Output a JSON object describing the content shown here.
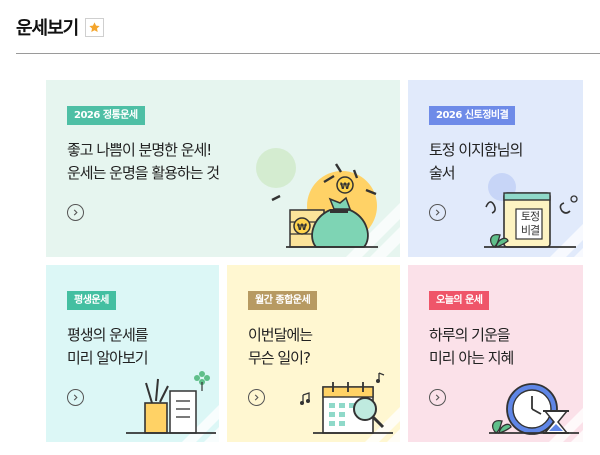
{
  "header": {
    "title": "운세보기",
    "favorite_icon": "star-icon"
  },
  "colors": {
    "badge_teal": "#4ebfa5",
    "badge_blue": "#6e8be8",
    "badge_green": "#44bfa1",
    "badge_brown": "#b79a62",
    "badge_red": "#ef5569"
  },
  "cards": [
    {
      "badge": "2026 정통운세",
      "title_lines": [
        "좋고 나쁨이 분명한 운세!",
        "운세는 운명을 활용하는 것"
      ],
      "icon": "money-bag-icon"
    },
    {
      "badge": "2026 신토정비결",
      "title_lines": [
        "토정 이지함님의",
        "술서"
      ],
      "icon": "book-icon",
      "book_text": [
        "토정",
        "비결"
      ]
    },
    {
      "badge": "평생운세",
      "title_lines": [
        "평생의 운세를",
        "미리 알아보기"
      ],
      "icon": "pencil-cup-icon"
    },
    {
      "badge": "월간 종합운세",
      "title_lines": [
        "이번달에는",
        "무슨 일이?"
      ],
      "icon": "calendar-magnifier-icon"
    },
    {
      "badge": "오늘의 운세",
      "title_lines": [
        "하루의 기운을",
        "미리 아는 지혜"
      ],
      "icon": "clock-hourglass-icon"
    }
  ]
}
